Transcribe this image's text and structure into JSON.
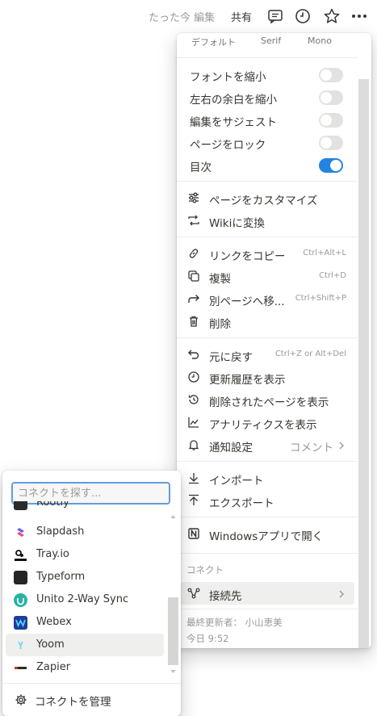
{
  "topbar": {
    "edited_text": "たった今 編集",
    "share_label": "共有",
    "icons": [
      "comment-icon",
      "clock-icon",
      "star-icon",
      "more-icon"
    ]
  },
  "menu": {
    "font_options": [
      "デフォルト",
      "Serif",
      "Mono"
    ],
    "toggles": [
      {
        "label": "フォントを縮小",
        "on": false
      },
      {
        "label": "左右の余白を縮小",
        "on": false
      },
      {
        "label": "編集をサジェスト",
        "on": false
      },
      {
        "label": "ページをロック",
        "on": false
      },
      {
        "label": "目次",
        "on": true
      }
    ],
    "customize_label": "ページをカスタマイズ",
    "wiki_label": "Wikiに変換",
    "copy_link": {
      "label": "リンクをコピー",
      "shortcut": "Ctrl+Alt+L"
    },
    "duplicate": {
      "label": "複製",
      "shortcut": "Ctrl+D"
    },
    "move": {
      "label": "別ページへ移...",
      "shortcut": "Ctrl+Shift+P"
    },
    "delete_label": "削除",
    "undo": {
      "label": "元に戻す",
      "shortcut": "Ctrl+Z or Alt+Del"
    },
    "history_label": "更新履歴を表示",
    "deleted_pages_label": "削除されたページを表示",
    "analytics_label": "アナリティクスを表示",
    "notify": {
      "label": "通知設定",
      "value": "コメント"
    },
    "import_label": "インポート",
    "export_label": "エクスポート",
    "open_app_label": "Windowsアプリで開く",
    "connect_section": "コネクト",
    "connect_label": "接続先",
    "last_edited_by": "最終更新者： 小山恵美",
    "last_edited_time": "今日 9:52",
    "accent": "#2383e2"
  },
  "connections": {
    "search_placeholder": "コネクトを探す...",
    "items": [
      {
        "name": "Rootly",
        "color": "#2b2b2b"
      },
      {
        "name": "Slapdash",
        "color": "#6b5cff"
      },
      {
        "name": "Tray.io",
        "color": "#111111"
      },
      {
        "name": "Typeform",
        "color": "#262627"
      },
      {
        "name": "Unito 2-Way Sync",
        "color": "#27b2a4"
      },
      {
        "name": "Webex",
        "color": "#1f3d99"
      },
      {
        "name": "Yoom",
        "color": "#7ad3f0"
      },
      {
        "name": "Zapier",
        "color": "#ff4a00"
      }
    ],
    "manage_label": "コネクトを管理"
  }
}
